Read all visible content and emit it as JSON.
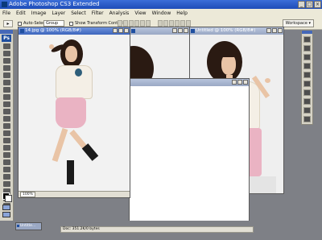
{
  "window": {
    "title": "Adobe Photoshop CS3 Extended",
    "controls": [
      "_",
      "□",
      "×"
    ]
  },
  "menu": [
    "File",
    "Edit",
    "Image",
    "Layer",
    "Select",
    "Filter",
    "Analysis",
    "View",
    "Window",
    "Help"
  ],
  "options_bar": {
    "auto_select_label": "Auto-Select:",
    "auto_select_value": "Group",
    "show_transform_label": "Show Transform Controls",
    "workspace_label": "Workspace ▾"
  },
  "toolbox": {
    "logo": "Ps"
  },
  "documents": {
    "front": {
      "title": "14.jpg @ 100% (RGB/8#)",
      "zoom": "100%"
    },
    "blank": {
      "title": ""
    },
    "right": {
      "title": "Untitled @ 100% (RGB/8#)"
    }
  },
  "status": {
    "doc_info": "Doc: 351.2K/0 bytes"
  },
  "minimized_doc": {
    "label": "Untitle..."
  }
}
